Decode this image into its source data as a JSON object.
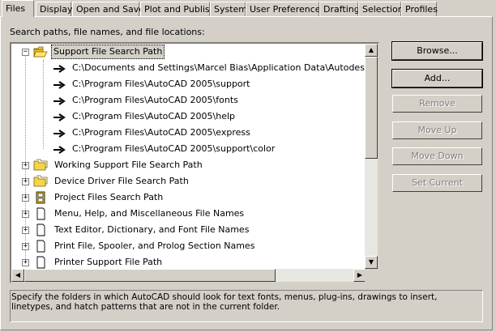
{
  "tabs": [
    {
      "label": "Files",
      "active": true
    },
    {
      "label": "Display"
    },
    {
      "label": "Open and Save"
    },
    {
      "label": "Plot and Publish"
    },
    {
      "label": "System"
    },
    {
      "label": "User Preferences"
    },
    {
      "label": "Drafting"
    },
    {
      "label": "Selection"
    },
    {
      "label": "Profiles"
    }
  ],
  "caption": "Search paths, file names, and file locations:",
  "tree": {
    "items": [
      {
        "label": "Support File Search Path",
        "expanded": true,
        "icon": "open-folder-icon",
        "children": [
          "C:\\Documents and Settings\\Marcel Bias\\Application Data\\Autodesk\\AutoCA",
          "C:\\Program Files\\AutoCAD 2005\\support",
          "C:\\Program Files\\AutoCAD 2005\\fonts",
          "C:\\Program Files\\AutoCAD 2005\\help",
          "C:\\Program Files\\AutoCAD 2005\\express",
          "C:\\Program Files\\AutoCAD 2005\\support\\color"
        ]
      },
      {
        "label": "Working Support File Search Path",
        "icon": "folder-icon"
      },
      {
        "label": "Device Driver File Search Path",
        "icon": "folder-icon"
      },
      {
        "label": "Project Files Search Path",
        "icon": "project-icon"
      },
      {
        "label": "Menu, Help, and Miscellaneous File Names",
        "icon": "document-icon"
      },
      {
        "label": "Text Editor, Dictionary, and Font File Names",
        "icon": "document-icon"
      },
      {
        "label": "Print File, Spooler, and Prolog Section Names",
        "icon": "document-icon"
      },
      {
        "label": "Printer Support File Path",
        "icon": "document-icon"
      }
    ]
  },
  "buttons": {
    "browse": "Browse...",
    "add": "Add...",
    "remove": "Remove",
    "move_up": "Move Up",
    "move_down": "Move Down",
    "set_current": "Set Current"
  },
  "description": "Specify the folders in which AutoCAD should look for text fonts, menus, plug-ins, drawings to insert, linetypes, and hatch patterns that are not in the current folder."
}
